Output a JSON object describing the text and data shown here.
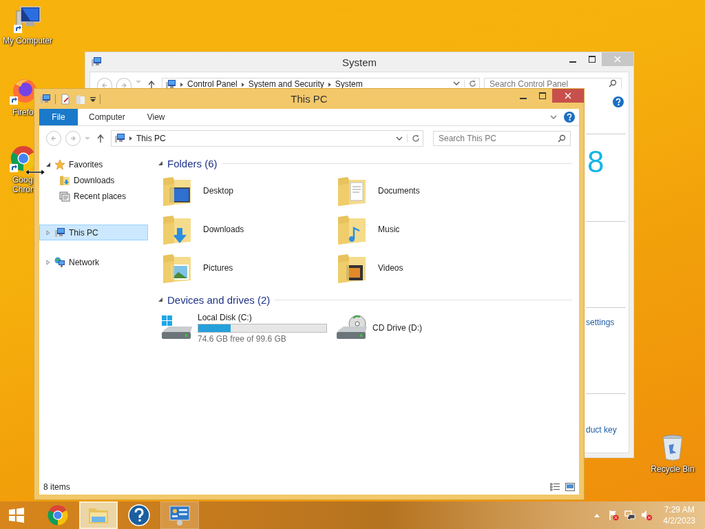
{
  "desktop_icons": [
    {
      "kind": "computer",
      "lines": [
        "My Computer"
      ]
    },
    {
      "kind": "firefox",
      "lines": [
        "Firefo"
      ]
    },
    {
      "kind": "chrome",
      "lines": [
        "Goog",
        "Chron"
      ]
    }
  ],
  "recycle_bin": {
    "label": "Recycle Bin"
  },
  "system_window": {
    "title": "System",
    "breadcrumb": [
      "Control Panel",
      "System and Security",
      "System"
    ],
    "search": {
      "placeholder": "Search Control Panel"
    },
    "logo_text": "8",
    "links": [
      "settings",
      "duct key"
    ]
  },
  "explorer": {
    "title": "This PC",
    "ribbon_tabs": [
      {
        "label": "File",
        "selected": true
      },
      {
        "label": "Computer",
        "selected": false
      },
      {
        "label": "View",
        "selected": false
      }
    ],
    "address": "This PC",
    "search": {
      "placeholder": "Search This PC"
    },
    "nav_tree": [
      {
        "label": "Favorites",
        "kind": "favorites",
        "expanded": true,
        "selected": false,
        "children": [
          {
            "label": "Downloads",
            "kind": "downloads",
            "selected": false
          },
          {
            "label": "Recent places",
            "kind": "recent",
            "selected": false
          }
        ]
      },
      {
        "label": "This PC",
        "kind": "pc",
        "expanded": false,
        "selected": true
      },
      {
        "label": "Network",
        "kind": "network",
        "expanded": false,
        "selected": false
      }
    ],
    "groups": [
      {
        "title": "Folders (6)",
        "expanded": true,
        "items": [
          {
            "kind": "desktop",
            "name": "Desktop"
          },
          {
            "kind": "documents",
            "name": "Documents"
          },
          {
            "kind": "downloads",
            "name": "Downloads"
          },
          {
            "kind": "music",
            "name": "Music"
          },
          {
            "kind": "pictures",
            "name": "Pictures"
          },
          {
            "kind": "videos",
            "name": "Videos"
          }
        ]
      },
      {
        "title": "Devices and drives (2)",
        "expanded": true,
        "items": [
          {
            "kind": "hdd",
            "name": "Local Disk (C:)",
            "level": 0.25,
            "detail": "74.6 GB free of 99.6 GB"
          },
          {
            "kind": "cd",
            "name": "CD Drive (D:)"
          }
        ]
      }
    ],
    "status": "8 items"
  },
  "taskbar": {
    "items": [
      {
        "kind": "start",
        "selected": false,
        "running": false
      },
      {
        "kind": "chrome",
        "selected": false,
        "running": false
      },
      {
        "kind": "explorer",
        "selected": true,
        "running": true
      },
      {
        "kind": "help",
        "selected": false,
        "running": false
      },
      {
        "kind": "system",
        "selected": false,
        "running": true
      }
    ],
    "time": "7:29 AM",
    "date": "4/2/2023"
  }
}
